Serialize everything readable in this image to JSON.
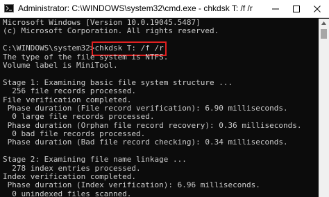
{
  "window": {
    "title": "Administrator: C:\\WINDOWS\\system32\\cmd.exe - chkdsk  T: /f /r",
    "icon": "cmd-icon",
    "controls": [
      "minimize-icon",
      "maximize-icon",
      "close-icon"
    ]
  },
  "console": {
    "lines_before": [
      "Microsoft Windows [Version 10.0.19045.5487]",
      "(c) Microsoft Corporation. All rights reserved.",
      ""
    ],
    "prompt": "C:\\WINDOWS\\system32>",
    "command": "chkdsk T: /f /r",
    "lines_after": [
      "The type of the file system is NTFS.",
      "Volume label is MiniTool.",
      "",
      "Stage 1: Examining basic file system structure ...",
      "  256 file records processed.",
      "File verification completed.",
      " Phase duration (File record verification): 6.90 milliseconds.",
      "  0 large file records processed.",
      " Phase duration (Orphan file record recovery): 0.36 milliseconds.",
      "  0 bad file records processed.",
      " Phase duration (Bad file record checking): 0.34 milliseconds.",
      "",
      "Stage 2: Examining file name linkage ...",
      "  278 index entries processed.",
      "Index verification completed.",
      " Phase duration (Index verification): 6.96 milliseconds.",
      "  0 unindexed files scanned."
    ]
  },
  "colors": {
    "console_background": "#0c0c0c",
    "console_text": "#cccccc",
    "highlight_box": "#e02020",
    "titlebar": "#ffffff"
  }
}
